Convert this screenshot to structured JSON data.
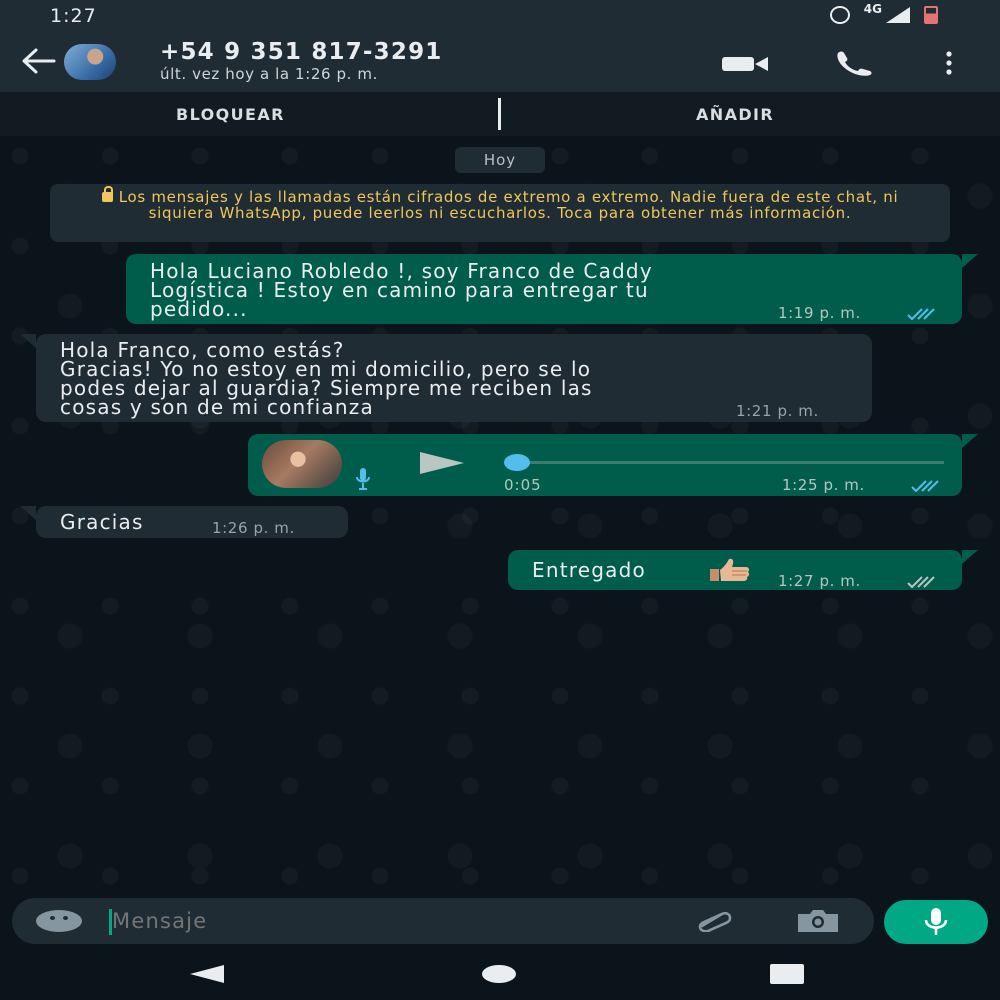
{
  "status_bar": {
    "time": "1:27",
    "network": "4G"
  },
  "header": {
    "contact_name": "+54 9 351 817-3291",
    "last_seen": "últ. vez hoy a la 1:26 p. m."
  },
  "actions": {
    "block_label": "BLOQUEAR",
    "add_label": "AÑADIR"
  },
  "chat": {
    "date_chip": "Hoy",
    "encryption_notice": "Los mensajes y las llamadas están cifrados de extremo a extremo. Nadie fuera de este chat, ni siquiera WhatsApp, puede leerlos ni escucharlos. Toca para obtener más información.",
    "messages": [
      {
        "direction": "outgoing",
        "lines": [
          "Hola Luciano Robledo !, soy Franco de Caddy",
          "Logística ! Estoy en camino para entregar tu",
          "pedido..."
        ],
        "time": "1:19 p. m.",
        "status": "read"
      },
      {
        "direction": "incoming",
        "lines": [
          "Hola Franco, como estás?",
          "Gracias! Yo no estoy en mi domicilio, pero se lo",
          "podes dejar al guardia? Siempre me reciben las",
          "cosas y son de mi confianza"
        ],
        "time": "1:21 p. m."
      },
      {
        "direction": "outgoing",
        "type": "voice",
        "duration": "0:05",
        "progress": 0,
        "time": "1:25 p. m.",
        "status": "read"
      },
      {
        "direction": "incoming",
        "lines": [
          "Gracias"
        ],
        "time": "1:26 p. m."
      },
      {
        "direction": "outgoing",
        "lines": [
          "Entregado"
        ],
        "emoji": "thumbs-up",
        "time": "1:27 p. m.",
        "status": "delivered"
      }
    ]
  },
  "input": {
    "placeholder": "Mensaje"
  },
  "colors": {
    "outgoing_bubble": "#005c4b",
    "incoming_bubble": "#1f2c33",
    "accent": "#00a884",
    "read_ticks": "#53bdeb",
    "notice_text": "#f1c65a"
  }
}
